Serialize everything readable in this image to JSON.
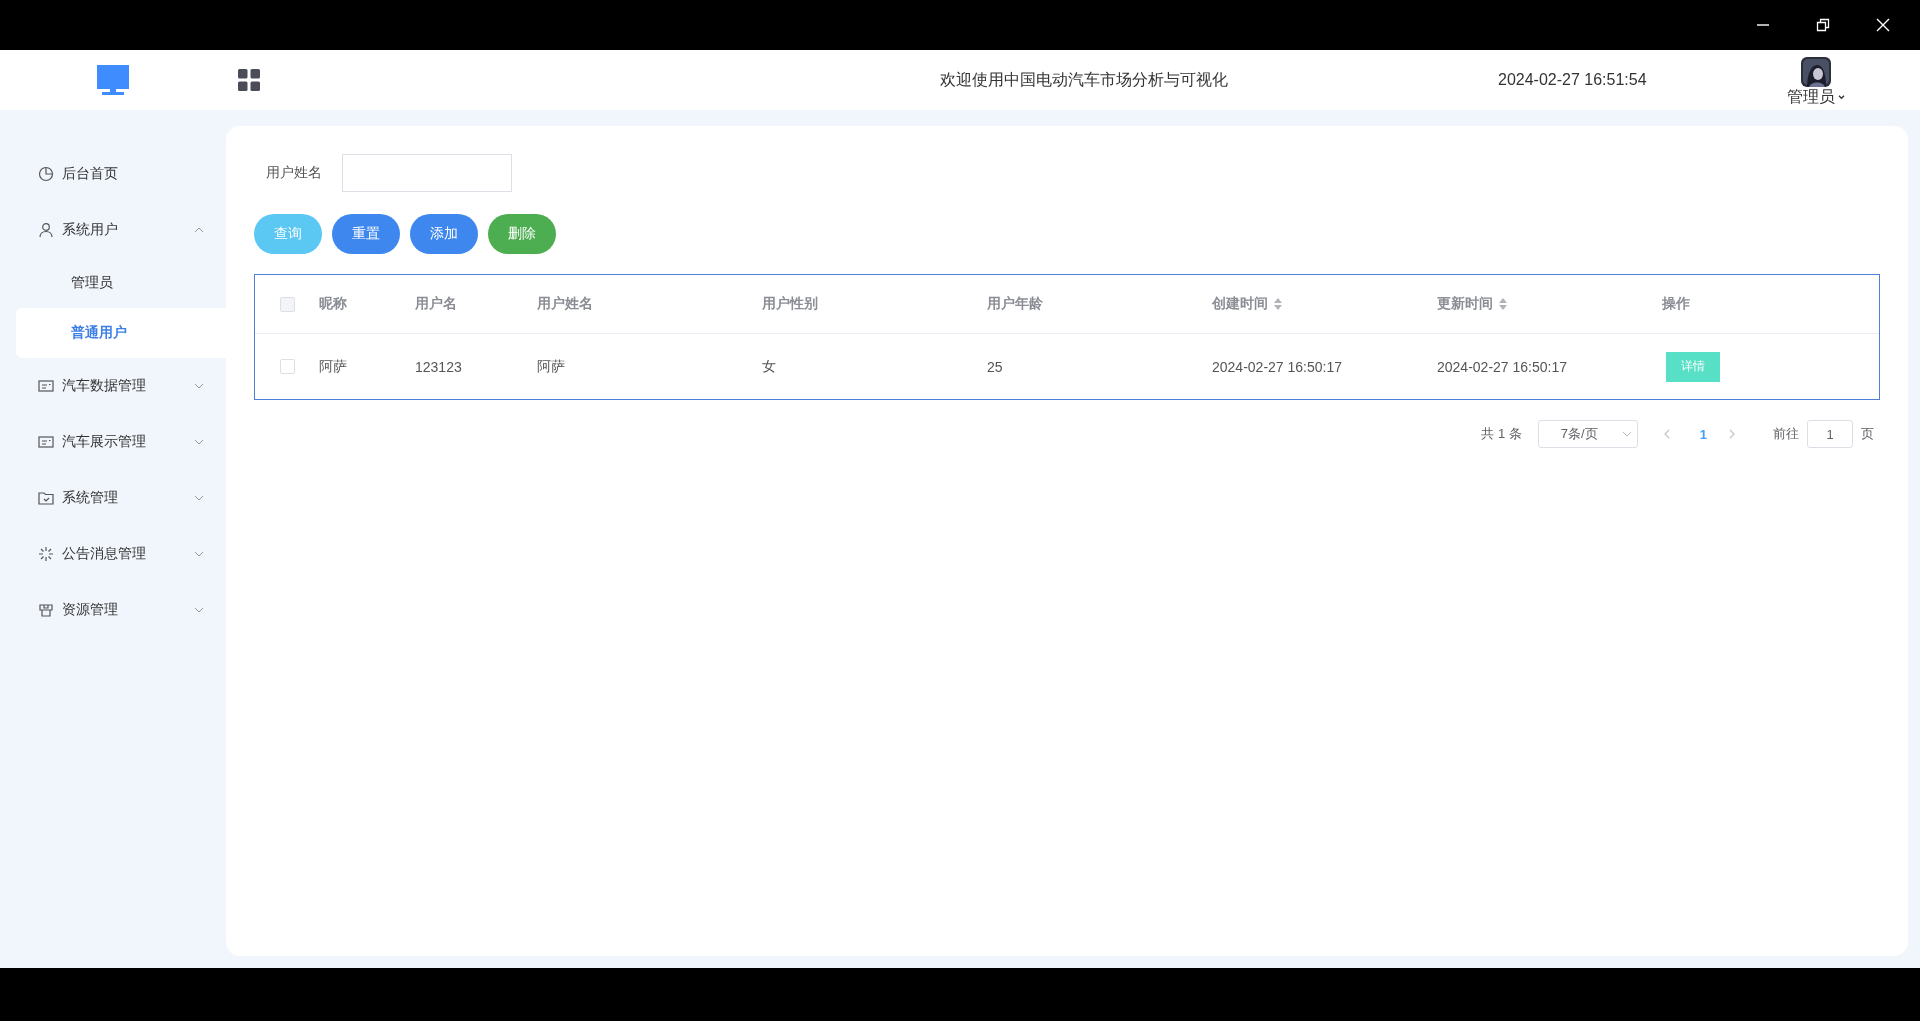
{
  "header": {
    "title": "欢迎使用中国电动汽车市场分析与可视化",
    "datetime": "2024-02-27 16:51:54",
    "user": {
      "name": "管理员"
    }
  },
  "sidebar": {
    "items": [
      {
        "label": "后台首页"
      },
      {
        "label": "系统用户",
        "expanded": true,
        "children": [
          {
            "label": "管理员",
            "selected": false
          },
          {
            "label": "普通用户",
            "selected": true
          }
        ]
      },
      {
        "label": "汽车数据管理",
        "expanded": false
      },
      {
        "label": "汽车展示管理",
        "expanded": false
      },
      {
        "label": "系统管理",
        "expanded": false
      },
      {
        "label": "公告消息管理",
        "expanded": false
      },
      {
        "label": "资源管理",
        "expanded": false
      }
    ]
  },
  "search": {
    "label": "用户姓名"
  },
  "buttons": [
    {
      "label": "查询",
      "kind": "query"
    },
    {
      "label": "重置",
      "kind": "reset"
    },
    {
      "label": "添加",
      "kind": "add"
    },
    {
      "label": "删除",
      "kind": "delete"
    }
  ],
  "table": {
    "all_checked": false,
    "columns": [
      {
        "label": "昵称",
        "sortable": false
      },
      {
        "label": "用户名",
        "sortable": false
      },
      {
        "label": "用户姓名",
        "sortable": false
      },
      {
        "label": "用户性别",
        "sortable": false
      },
      {
        "label": "用户年龄",
        "sortable": false
      },
      {
        "label": "创建时间",
        "sortable": true
      },
      {
        "label": "更新时间",
        "sortable": true
      },
      {
        "label": "操作",
        "sortable": false
      }
    ],
    "rows": [
      {
        "checked": false,
        "cells": [
          "阿萨",
          "123123",
          "阿萨",
          "女",
          "25",
          "2024-02-27 16:50:17",
          "2024-02-27 16:50:17"
        ],
        "action": "详情"
      }
    ]
  },
  "pagination": {
    "total": "共 1 条",
    "page_size": "7条/页",
    "pages": [
      {
        "label": "1",
        "selected": true
      }
    ],
    "goto_label": "前往",
    "goto_value": "1",
    "goto_suffix": "页"
  }
}
